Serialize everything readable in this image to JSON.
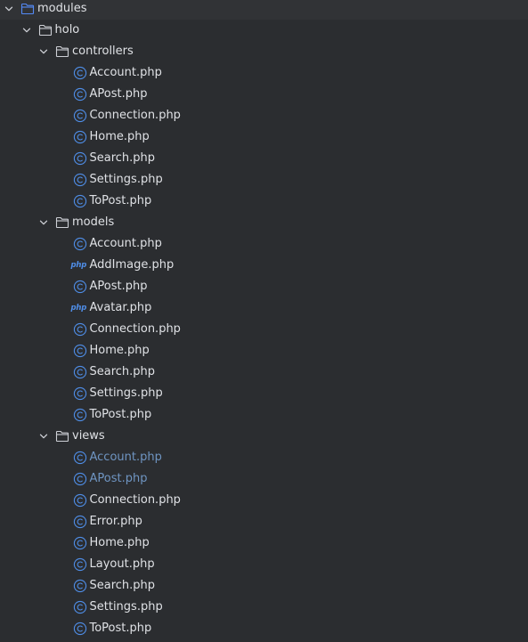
{
  "colors": {
    "background": "#2b2d30",
    "text": "#dfe1e5",
    "vcs_modified_text": "#6f95c2",
    "class_icon": "#4f8ee8",
    "folder_icon": "#ced0d6",
    "module_folder_icon": "#548af7"
  },
  "tree": [
    {
      "label": "modules",
      "kind": "module-folder",
      "depth": 0,
      "expanded": true,
      "status": "normal"
    },
    {
      "label": "holo",
      "kind": "folder",
      "depth": 1,
      "expanded": true,
      "status": "normal"
    },
    {
      "label": "controllers",
      "kind": "folder",
      "depth": 2,
      "expanded": true,
      "status": "normal"
    },
    {
      "label": "Account.php",
      "kind": "class",
      "depth": 3,
      "status": "normal"
    },
    {
      "label": "APost.php",
      "kind": "class",
      "depth": 3,
      "status": "normal"
    },
    {
      "label": "Connection.php",
      "kind": "class",
      "depth": 3,
      "status": "normal"
    },
    {
      "label": "Home.php",
      "kind": "class",
      "depth": 3,
      "status": "normal"
    },
    {
      "label": "Search.php",
      "kind": "class",
      "depth": 3,
      "status": "normal"
    },
    {
      "label": "Settings.php",
      "kind": "class",
      "depth": 3,
      "status": "normal"
    },
    {
      "label": "ToPost.php",
      "kind": "class",
      "depth": 3,
      "status": "normal"
    },
    {
      "label": "models",
      "kind": "folder",
      "depth": 2,
      "expanded": true,
      "status": "normal"
    },
    {
      "label": "Account.php",
      "kind": "class",
      "depth": 3,
      "status": "normal"
    },
    {
      "label": "AddImage.php",
      "kind": "php",
      "depth": 3,
      "status": "normal"
    },
    {
      "label": "APost.php",
      "kind": "class",
      "depth": 3,
      "status": "normal"
    },
    {
      "label": "Avatar.php",
      "kind": "php",
      "depth": 3,
      "status": "normal"
    },
    {
      "label": "Connection.php",
      "kind": "class",
      "depth": 3,
      "status": "normal"
    },
    {
      "label": "Home.php",
      "kind": "class",
      "depth": 3,
      "status": "normal"
    },
    {
      "label": "Search.php",
      "kind": "class",
      "depth": 3,
      "status": "normal"
    },
    {
      "label": "Settings.php",
      "kind": "class",
      "depth": 3,
      "status": "normal"
    },
    {
      "label": "ToPost.php",
      "kind": "class",
      "depth": 3,
      "status": "normal"
    },
    {
      "label": "views",
      "kind": "folder",
      "depth": 2,
      "expanded": true,
      "status": "normal"
    },
    {
      "label": "Account.php",
      "kind": "class",
      "depth": 3,
      "status": "modified"
    },
    {
      "label": "APost.php",
      "kind": "class",
      "depth": 3,
      "status": "modified"
    },
    {
      "label": "Connection.php",
      "kind": "class",
      "depth": 3,
      "status": "normal"
    },
    {
      "label": "Error.php",
      "kind": "class",
      "depth": 3,
      "status": "normal"
    },
    {
      "label": "Home.php",
      "kind": "class",
      "depth": 3,
      "status": "normal"
    },
    {
      "label": "Layout.php",
      "kind": "class",
      "depth": 3,
      "status": "normal"
    },
    {
      "label": "Search.php",
      "kind": "class",
      "depth": 3,
      "status": "normal"
    },
    {
      "label": "Settings.php",
      "kind": "class",
      "depth": 3,
      "status": "normal"
    },
    {
      "label": "ToPost.php",
      "kind": "class",
      "depth": 3,
      "status": "normal"
    }
  ],
  "icons": {
    "expanded": "chevron-down-icon",
    "folder": "folder-icon",
    "module-folder": "module-folder-icon",
    "class": "php-class-icon",
    "php": "php-file-icon",
    "php_badge_text": "php"
  }
}
